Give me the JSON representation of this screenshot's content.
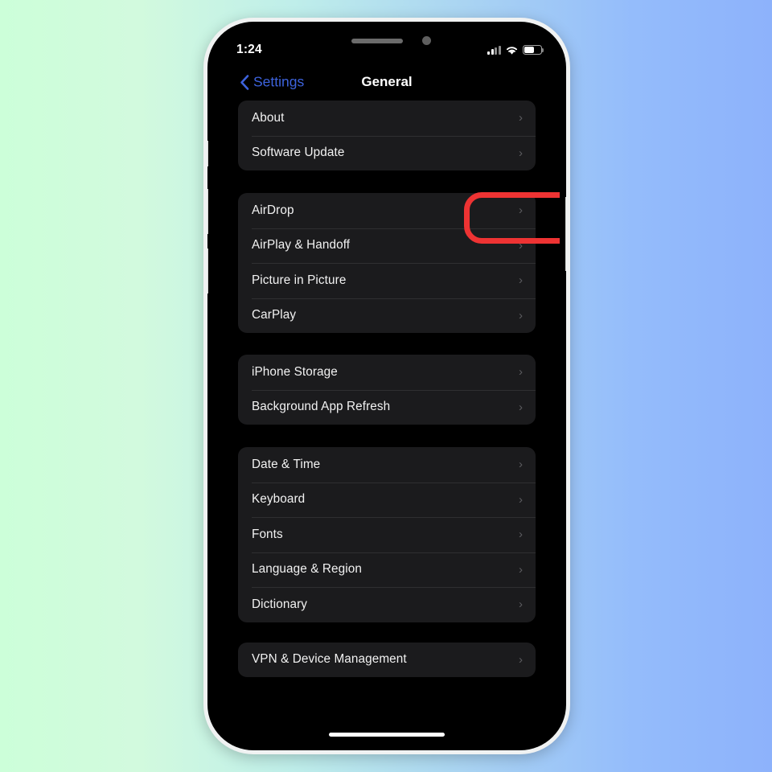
{
  "background": {
    "gradient_start": "#ccffd9",
    "gradient_end": "#8db2fb"
  },
  "device": {
    "bezel_color": "#f0f2f2",
    "body_color": "#000000",
    "hardware_buttons": [
      "mute-switch",
      "volume-up",
      "volume-down",
      "power-button"
    ]
  },
  "status_bar": {
    "time": "1:24",
    "cellular_icon": "signal-bars-icon",
    "wifi_icon": "wifi-icon",
    "battery_icon": "battery-icon",
    "battery_level_percent": 62
  },
  "nav_bar": {
    "back_label": "Settings",
    "back_icon": "chevron-left-icon",
    "back_tint": "#3d63dd",
    "title": "General"
  },
  "groups": [
    {
      "id": "group-system",
      "rows": [
        {
          "label": "About",
          "accessory": "chevron-right-icon"
        },
        {
          "label": "Software Update",
          "accessory": "chevron-right-icon"
        }
      ]
    },
    {
      "id": "group-sharing",
      "rows": [
        {
          "label": "AirDrop",
          "accessory": "chevron-right-icon"
        },
        {
          "label": "AirPlay & Handoff",
          "accessory": "chevron-right-icon"
        },
        {
          "label": "Picture in Picture",
          "accessory": "chevron-right-icon"
        },
        {
          "label": "CarPlay",
          "accessory": "chevron-right-icon"
        }
      ]
    },
    {
      "id": "group-storage",
      "rows": [
        {
          "label": "iPhone Storage",
          "accessory": "chevron-right-icon"
        },
        {
          "label": "Background App Refresh",
          "accessory": "chevron-right-icon"
        }
      ]
    },
    {
      "id": "group-region",
      "rows": [
        {
          "label": "Date & Time",
          "accessory": "chevron-right-icon"
        },
        {
          "label": "Keyboard",
          "accessory": "chevron-right-icon"
        },
        {
          "label": "Fonts",
          "accessory": "chevron-right-icon"
        },
        {
          "label": "Language & Region",
          "accessory": "chevron-right-icon"
        },
        {
          "label": "Dictionary",
          "accessory": "chevron-right-icon"
        }
      ]
    },
    {
      "id": "group-management",
      "rows": [
        {
          "label": "VPN & Device Management",
          "accessory": "chevron-right-icon"
        }
      ]
    }
  ],
  "annotation": {
    "shape": "rounded-rectangle-outline",
    "color": "#ee3333",
    "targets_row_label": "Software Update"
  },
  "chevron_glyph": "›",
  "row_background": "#1b1b1d",
  "screen_background": "#000000"
}
